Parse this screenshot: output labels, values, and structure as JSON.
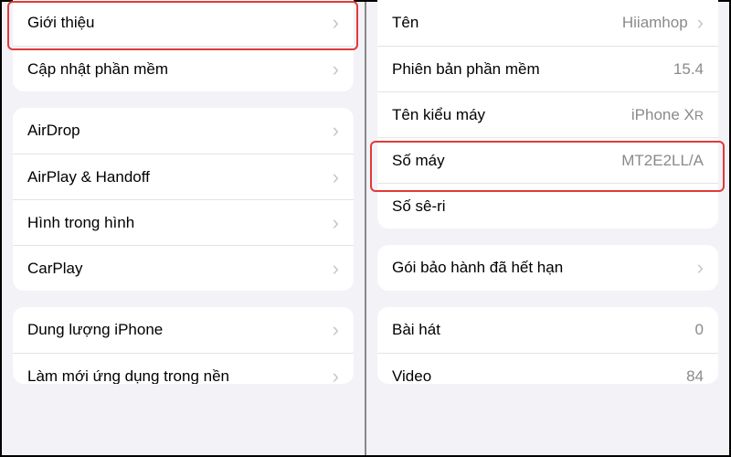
{
  "left": {
    "group1": [
      {
        "label": "Giới thiệu"
      },
      {
        "label": "Cập nhật phần mềm"
      }
    ],
    "group2": [
      {
        "label": "AirDrop"
      },
      {
        "label": "AirPlay & Handoff"
      },
      {
        "label": "Hình trong hình"
      },
      {
        "label": "CarPlay"
      }
    ],
    "group3": [
      {
        "label": "Dung lượng iPhone"
      },
      {
        "label": "Làm mới ứng dụng trong nền"
      }
    ]
  },
  "right": {
    "group1": [
      {
        "label": "Tên",
        "value": "Hiiamhop",
        "chevron": true
      },
      {
        "label": "Phiên bản phần mềm",
        "value": "15.4"
      },
      {
        "label": "Tên kiểu máy",
        "value": "iPhone XR"
      },
      {
        "label": "Số máy",
        "value": "MT2E2LL/A"
      },
      {
        "label": "Số sê-ri",
        "value": ""
      }
    ],
    "group2": [
      {
        "label": "Gói bảo hành đã hết hạn",
        "chevron": true
      }
    ],
    "group3": [
      {
        "label": "Bài hát",
        "value": "0"
      },
      {
        "label": "Video",
        "value": "84"
      }
    ]
  }
}
